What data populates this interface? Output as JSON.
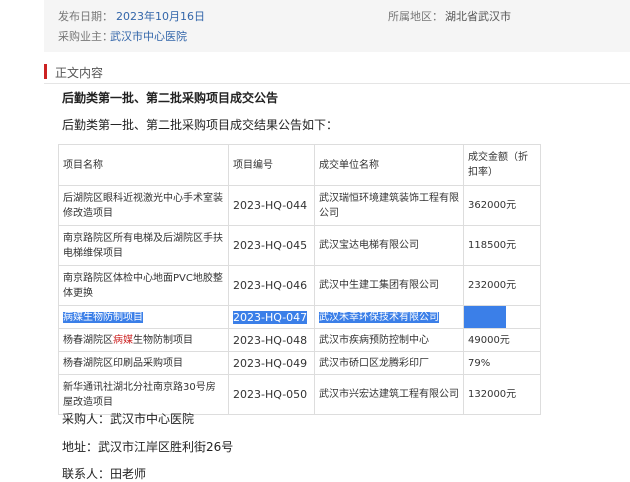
{
  "meta": {
    "publish_date_label": "发布日期：",
    "publish_date": "2023年10月16日",
    "region_label": "所属地区：",
    "region": "湖北省武汉市",
    "buyer_label": "采购业主：",
    "buyer": "武汉市中心医院"
  },
  "section": {
    "title": "正文内容"
  },
  "notice": {
    "title": "后勤类第一批、第二批采购项目成交公告",
    "intro": "后勤类第一批、第二批采购项目成交结果公告如下："
  },
  "table": {
    "headers": [
      "项目名称",
      "项目编号",
      "成交单位名称",
      "成交金额（折扣率）"
    ],
    "rows": [
      {
        "name": "后湖院区眼科近视激光中心手术室装修改造项目",
        "code": "2023-HQ-044",
        "company": "武汉瑞恒环境建筑装饰工程有限公司",
        "amount": "362000元"
      },
      {
        "name": "南京路院区所有电梯及后湖院区手扶电梯维保项目",
        "code": "2023-HQ-045",
        "company": "武汉宝达电梯有限公司",
        "amount": "118500元"
      },
      {
        "name": "南京路院区体检中心地面PVC地胶整体更换",
        "code": "2023-HQ-046",
        "company": "武汉中生建工集团有限公司",
        "amount": "232000元"
      },
      {
        "name": "病媒生物防制项目",
        "code": "2023-HQ-047",
        "company": "武汉禾幸环保技术有限公司",
        "amount": ""
      },
      {
        "name_prefix": "杨春湖院区",
        "name_highlight": "病媒",
        "name_suffix": "生物防制项目",
        "code": "2023-HQ-048",
        "company": "武汉市疾病预防控制中心",
        "amount": "49000元"
      },
      {
        "name": "杨春湖院区印刷品采购项目",
        "code": "2023-HQ-049",
        "company": "武汉市硚口区龙腾彩印厂",
        "amount": "79%"
      },
      {
        "name": "新华通讯社湖北分社南京路30号房屋改造项目",
        "code": "2023-HQ-050",
        "company": "武汉市兴宏达建筑工程有限公司",
        "amount": "132000元"
      }
    ]
  },
  "footer": {
    "purchaser": "采购人：武汉市中心医院",
    "address": "地址：武汉市江岸区胜利街26号",
    "contact": "联系人：田老师"
  }
}
